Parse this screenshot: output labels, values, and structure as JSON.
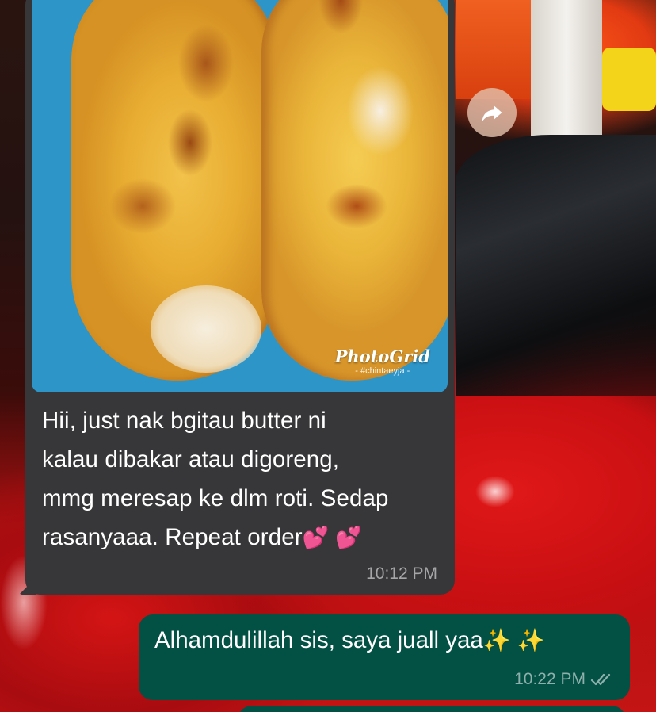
{
  "photo": {
    "watermark_title": "PhotoGrid",
    "watermark_sub": "- #chintaeyja -"
  },
  "incoming_message": {
    "lines": [
      "Hii, just nak bgitau butter ni",
      "kalau dibakar atau digoreng,",
      "mmg meresap ke dlm roti. Sedap",
      "rasanyaaa. Repeat order"
    ],
    "emoji": "💕 💕",
    "time": "10:12 PM"
  },
  "outgoing_message": {
    "text": "Alhamdulillah sis, saya juall yaa",
    "emoji": "✨ ✨",
    "time": "10:22 PM"
  },
  "colors": {
    "incoming_bubble": "#373739",
    "outgoing_bubble": "#025144",
    "read_ticks": "#8fb0aa"
  },
  "icons": [
    "forward-icon",
    "double-check-icon"
  ]
}
